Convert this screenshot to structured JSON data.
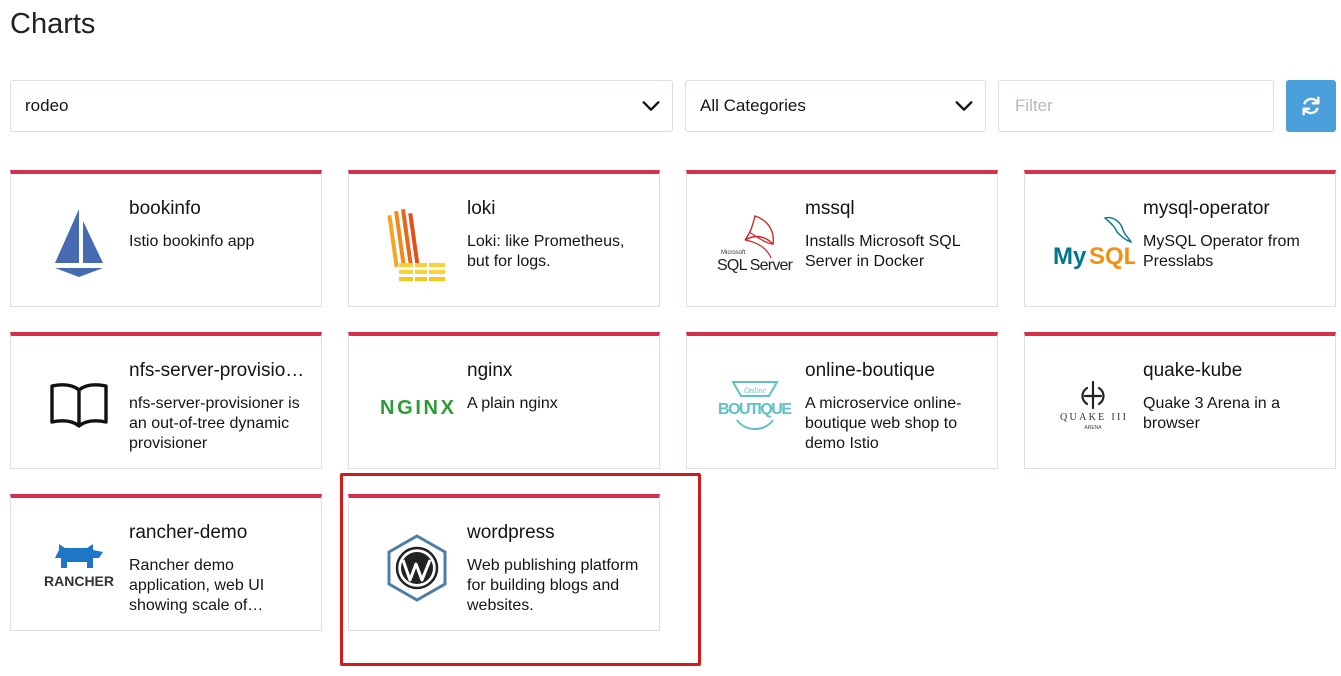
{
  "page": {
    "title": "Charts"
  },
  "toolbar": {
    "repo_select": {
      "value": "rodeo"
    },
    "category_select": {
      "value": "All Categories"
    },
    "filter": {
      "placeholder": "Filter",
      "value": ""
    },
    "refresh_icon": "refresh-icon"
  },
  "colors": {
    "card_accent": "#d6314b",
    "refresh_button": "#4b9fdb",
    "highlight_border": "#d01b1b"
  },
  "charts": [
    {
      "name": "bookinfo",
      "description": "Istio bookinfo app",
      "logo": "istio-sail-logo"
    },
    {
      "name": "loki",
      "description": "Loki: like Prometheus, but for logs.",
      "logo": "loki-logo"
    },
    {
      "name": "mssql",
      "description": "Installs Microsoft SQL Server in Docker",
      "logo": "sql-server-logo",
      "logo_text": "SQL Server",
      "logo_subtext": "Microsoft"
    },
    {
      "name": "mysql-operator",
      "description": "MySQL Operator from Presslabs",
      "logo": "mysql-logo",
      "logo_text_a": "My",
      "logo_text_b": "SQL"
    },
    {
      "name": "nfs-server-provisioner",
      "description": "nfs-server-provisioner is an out-of-tree dynamic provisioner",
      "logo": "book-logo"
    },
    {
      "name": "nginx",
      "description": "A plain nginx",
      "logo": "nginx-logo",
      "logo_text": "NGINX"
    },
    {
      "name": "online-boutique",
      "description": "A microservice online-boutique web shop to demo Istio",
      "logo": "boutique-logo",
      "logo_text": "BOUTIQUE",
      "logo_subtext": "Online"
    },
    {
      "name": "quake-kube",
      "description": "Quake 3 Arena in a browser",
      "logo": "quake-logo",
      "logo_text": "QUAKE III",
      "logo_subtext": "ARENA"
    },
    {
      "name": "rancher-demo",
      "description": "Rancher demo application, web UI showing scale of deployments",
      "logo": "rancher-logo",
      "logo_text": "RANCHER"
    },
    {
      "name": "wordpress",
      "description": "Web publishing platform for building blogs and websites.",
      "logo": "wordpress-logo",
      "highlighted": true
    }
  ]
}
